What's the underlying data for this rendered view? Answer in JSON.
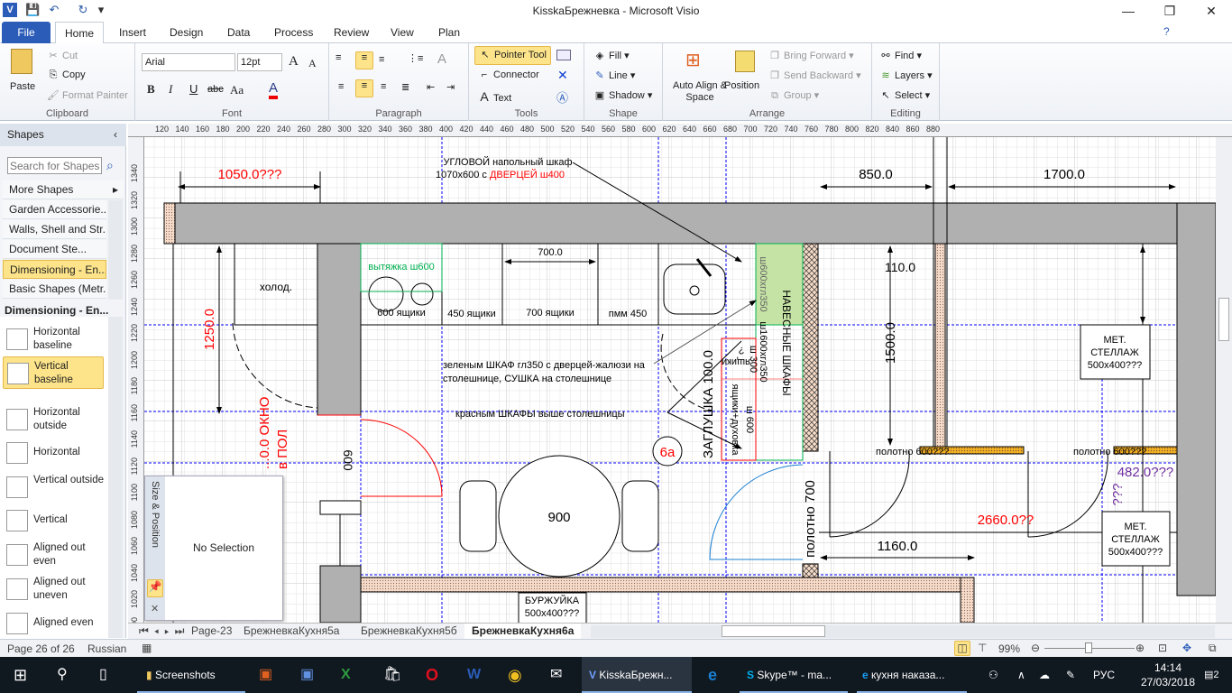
{
  "window": {
    "title": "KisskaБрежневка - Microsoft Visio",
    "minimize": "—",
    "restore": "❐",
    "close": "✕"
  },
  "qat": {
    "app_icon": "V",
    "save": "💾",
    "undo": "↶",
    "redo": "↻",
    "customize": "▾"
  },
  "tabs": [
    {
      "label": "File"
    },
    {
      "label": "Home"
    },
    {
      "label": "Insert"
    },
    {
      "label": "Design"
    },
    {
      "label": "Data"
    },
    {
      "label": "Process"
    },
    {
      "label": "Review"
    },
    {
      "label": "View"
    },
    {
      "label": "Plan"
    }
  ],
  "ribbon": {
    "clipboard": {
      "label": "Clipboard",
      "paste": "Paste",
      "cut": "Cut",
      "copy": "Copy",
      "format_painter": "Format Painter"
    },
    "font": {
      "label": "Font",
      "family": "Arial",
      "size": "12pt",
      "bold": "B",
      "italic": "I",
      "underline": "U",
      "strike": "abc",
      "case": "Aa",
      "color": "A",
      "grow": "A",
      "shrink": "A"
    },
    "paragraph": {
      "label": "Paragraph"
    },
    "tools": {
      "label": "Tools",
      "pointer": "Pointer Tool",
      "connector": "Connector",
      "text": "Text"
    },
    "shape": {
      "label": "Shape",
      "fill": "Fill",
      "line": "Line",
      "shadow": "Shadow"
    },
    "arrange": {
      "label": "Arrange",
      "auto_align": "Auto Align & Space",
      "position": "Position",
      "bring_forward": "Bring Forward",
      "send_backward": "Send Backward",
      "group": "Group"
    },
    "editing": {
      "label": "Editing",
      "find": "Find",
      "layers": "Layers",
      "select": "Select"
    }
  },
  "shapes_panel": {
    "title": "Shapes",
    "search_placeholder": "Search for Shapes",
    "more_shapes": "More Shapes",
    "stencils": [
      "Garden Accessorie...",
      "Walls, Shell and Str...",
      "Document Ste...",
      "Dimensioning - En...",
      "Basic Shapes (Metr..."
    ],
    "active_stencil": "Dimensioning - En...",
    "masters": [
      "Horizontal baseline",
      "Vertical baseline",
      "Horizontal outside",
      "Horizontal",
      "Vertical outside",
      "Vertical",
      "Aligned out even",
      "Aligned out uneven",
      "Aligned even"
    ],
    "selected_master": "Vertical baseline"
  },
  "rulers": {
    "h": [
      "120",
      "140",
      "160",
      "180",
      "200",
      "220",
      "240",
      "260",
      "280",
      "300",
      "320",
      "340",
      "360",
      "380",
      "400",
      "420",
      "440",
      "460",
      "480",
      "500",
      "520",
      "540",
      "560",
      "580",
      "600",
      "620",
      "640",
      "660",
      "680",
      "700",
      "720",
      "740",
      "760",
      "780",
      "800",
      "820",
      "840",
      "860",
      "880"
    ],
    "v": [
      "1340",
      "1320",
      "1300",
      "1280",
      "1260",
      "1240",
      "1220",
      "1200",
      "1180",
      "1160",
      "1140",
      "1120",
      "1100",
      "1080",
      "1060",
      "1040",
      "1020",
      "1000"
    ]
  },
  "drawing": {
    "dim_1050": "1050.0???",
    "dim_850": "850.0",
    "dim_1700": "1700.0",
    "dim_700": "700.0",
    "dim_110": "110.0",
    "dim_1500": "1500.0",
    "dim_1250": "1250.0",
    "note_corner_1": "УГЛОВОЙ напольный шкаф",
    "note_corner_2": "1070x600 с ",
    "note_corner_red": "ДВЕРЦЕЙ ш400",
    "fridge": "холод.",
    "hood": "вытяжка ш600",
    "drawers_600": "600 ящики",
    "drawers_450": "450 ящики",
    "drawers_700": "700 ящики",
    "dishwasher": "пмм 450",
    "wall_cab_1": "ш600хгл350",
    "wall_cab_2": "ш1600хгл350",
    "wall_cabinets": "НАВЕСНЫЕ ШКАФЫ",
    "red_cab_1a": "ящики",
    "red_cab_1b": "?",
    "red_cab_1c": "ш 300",
    "red_cab_2a": "ящики+духовка",
    "red_cab_2b": "ш 600",
    "note_green_1": "зеленым ШКАФ гл350 с дверцей-жалюзи на",
    "note_green_2": "столешнице, СУШКА на столешнице",
    "note_red": "красным ШКАФЫ выше столешницы",
    "plug": "ЗАГЛУШКА 100.0",
    "room_label": "6а",
    "window_1": "...0.0 ОКНО",
    "window_2": "в ПОЛ",
    "opening_600": "600",
    "table": "900",
    "door_700": "полотно 700",
    "door_600_a": "полотно 600???",
    "door_600_b": "полотно 600???",
    "dim_482": "482.0???",
    "dim_482_v": "???",
    "dim_2660": "2660.0??",
    "dim_1160": "1160.0",
    "rack_1": [
      "МЕТ.",
      "СТЕЛЛАЖ",
      "500x400???"
    ],
    "rack_2": [
      "МЕТ.",
      "СТЕЛЛАЖ",
      "500x400???"
    ],
    "stove_1": "БУРЖУЙКА",
    "stove_2": "500x400???"
  },
  "size_position": {
    "title": "Size & Position",
    "content": "No Selection"
  },
  "page_tabs": [
    "Page-23",
    "БрежневкаКухня5а",
    "БрежневкаКухня5б",
    "БрежневкаКухня6а"
  ],
  "active_page": "БрежневкаКухня6а",
  "status": {
    "page": "Page 26 of 26",
    "language": "Russian",
    "zoom": "99%",
    "zoom_level_percent": 99
  },
  "taskbar": {
    "items": [
      "Screenshots",
      "KisskaБрежн...",
      "Skype™ - ma...",
      "кухня наказа..."
    ],
    "lang": "РУС",
    "time": "14:14",
    "date": "27/03/2018",
    "notifications": "2"
  },
  "colors": {
    "accent": "#2b5cb8",
    "selected": "#fde48a",
    "wall": "#b0b0b0",
    "green_fill": "#c5e3a4",
    "red": "#ff0000",
    "purple": "#7030a0",
    "guide": "#0000ff"
  }
}
